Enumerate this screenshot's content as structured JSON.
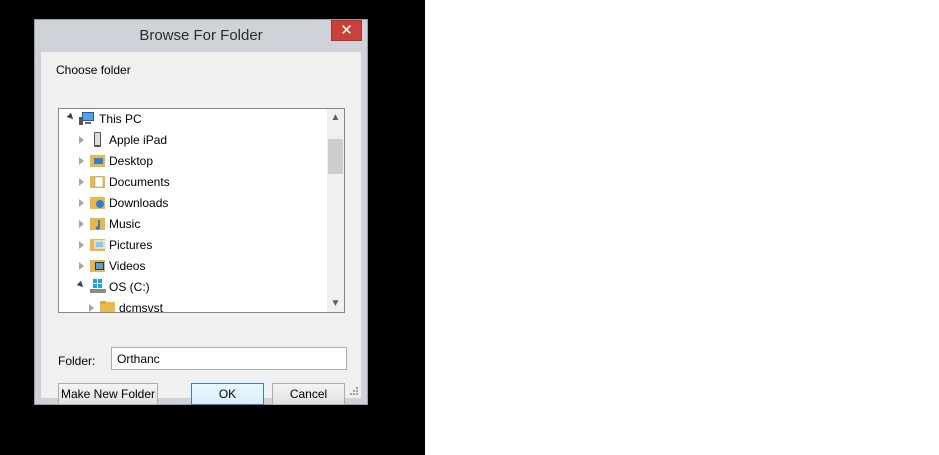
{
  "dialog": {
    "title": "Browse For Folder",
    "close_glyph": "✕",
    "instruction": "Choose folder",
    "folder_label": "Folder:",
    "folder_value": "Orthanc",
    "buttons": {
      "make_new_folder": "Make New Folder",
      "ok": "OK",
      "cancel": "Cancel"
    }
  },
  "tree": {
    "items": [
      {
        "label": "This PC",
        "icon": "computer-icon",
        "state": "expanded"
      },
      {
        "label": "Apple iPad",
        "icon": "ipad-device-icon",
        "state": "collapsed"
      },
      {
        "label": "Desktop",
        "icon": "desktop-folder-icon",
        "state": "collapsed"
      },
      {
        "label": "Documents",
        "icon": "documents-folder-icon",
        "state": "collapsed"
      },
      {
        "label": "Downloads",
        "icon": "downloads-folder-icon",
        "state": "collapsed"
      },
      {
        "label": "Music",
        "icon": "music-folder-icon",
        "state": "collapsed"
      },
      {
        "label": "Pictures",
        "icon": "pictures-folder-icon",
        "state": "collapsed"
      },
      {
        "label": "Videos",
        "icon": "videos-folder-icon",
        "state": "collapsed"
      },
      {
        "label": "OS (C:)",
        "icon": "drive-icon",
        "state": "expanded"
      },
      {
        "label": "dcmsvst",
        "icon": "folder-icon",
        "state": "collapsed"
      }
    ]
  },
  "scrollbar": {
    "up_glyph": "▲",
    "down_glyph": "▼"
  }
}
